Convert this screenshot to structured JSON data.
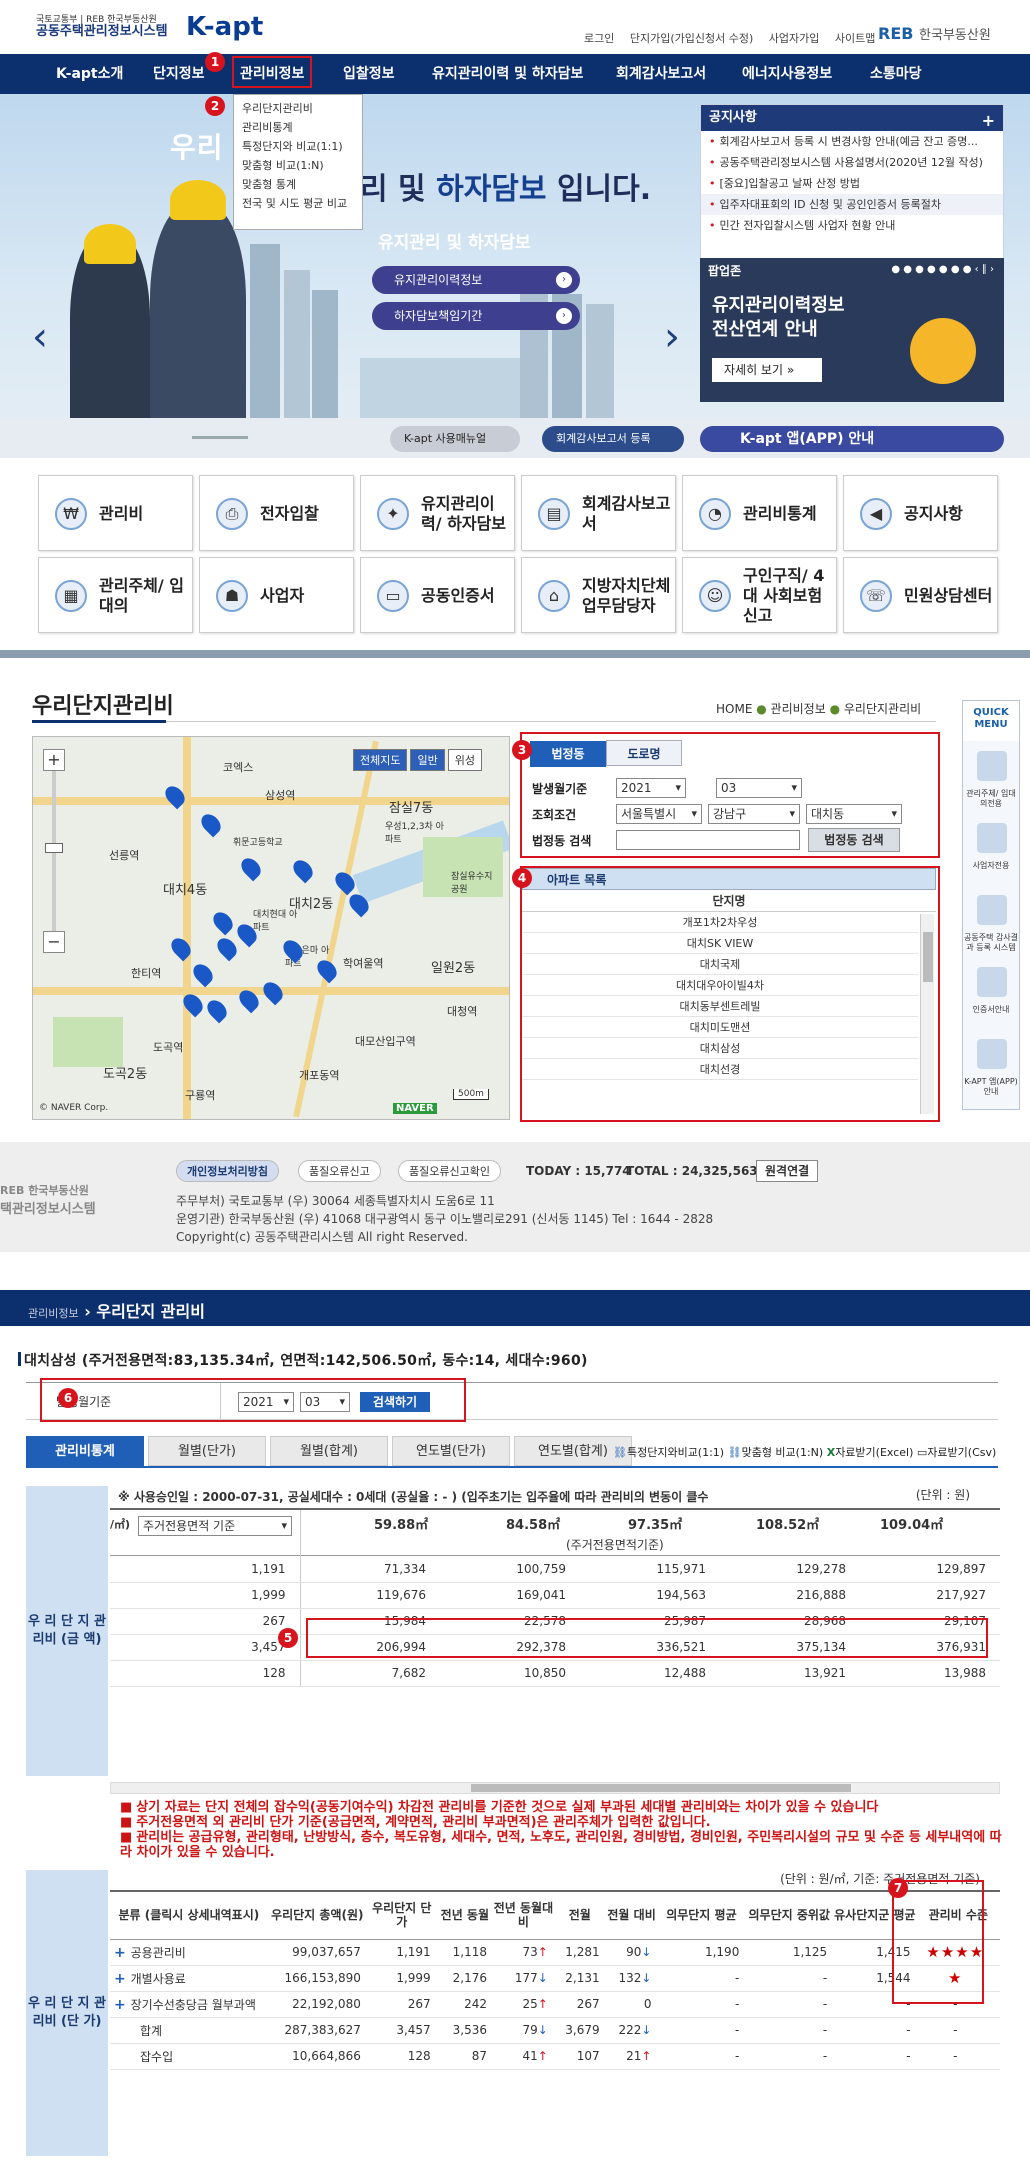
{
  "header": {
    "gov_top": "국토교통부 | REB 한국부동산원",
    "gov_name": "공동주택관리정보시스템",
    "brand": "K-apt",
    "util_links": [
      "로그인",
      "단지가입(가입신청서 수정)",
      "사업자가입",
      "사이트맵"
    ],
    "reb_logo": "REB",
    "reb_name": "한국부동산원"
  },
  "gnb": [
    "K-apt소개",
    "단지정보",
    "관리비정보",
    "입찰정보",
    "유지관리이력 및 하자담보",
    "회계감사보고서",
    "에너지사용정보",
    "소통마당"
  ],
  "dropdown": [
    "우리단지관리비",
    "관리비통계",
    "특정단지와 비교(1:1)",
    "맞춤형 비교(1:N)",
    "맞춤형 통계",
    "전국 및 시도 평균 비교"
  ],
  "badges": [
    "1",
    "2",
    "3",
    "4",
    "5",
    "6",
    "7"
  ],
  "hero": {
    "title_part": "우리",
    "title2_pre": "리",
    "title2_mid": " 및 ",
    "title2_hl": "하자담보",
    "title2_post": " 입니다.",
    "sub": "유지관리 및 하자담보",
    "btn1": "유지관리이력정보",
    "btn2": "하자담보책임기간",
    "bottom_btn1": "K-apt 사용매뉴얼",
    "bottom_btn2": "회계감사보고서 등록",
    "bottom_btn3": "K-apt 앱(APP) 안내"
  },
  "notice": {
    "title": "공지사항",
    "items": [
      "회계감사보고서 등록 시 변경사항 안내(예금 잔고 증명...",
      "공동주택관리정보시스템 사용설명서(2020년 12월 작성)",
      "[중요]입찰공고 날짜 산정 방법",
      "입주자대표회의 ID 신청 및 공인인증서 등록절차",
      "민간 전자입찰시스템 사업자 현황 안내"
    ]
  },
  "popup": {
    "title": "팝업존",
    "line1": "유지관리이력정보",
    "line2": "전산연계 안내",
    "more": "자세히 보기 »"
  },
  "quick_grid": [
    "관리비",
    "전자입찰",
    "유지관리이력/ 하자담보",
    "회계감사보고서",
    "관리비통계",
    "공지사항",
    "관리주체/ 입대의",
    "사업자",
    "공동인증서",
    "지방자치단체 업무담당자",
    "구인구직/ 4대 사회보험 신고",
    "민원상담센터"
  ],
  "section2": {
    "title": "우리단지관리비",
    "breadcrumb": [
      "HOME",
      "관리비정보",
      "우리단지관리비"
    ],
    "map_buttons": [
      "전체지도",
      "일반",
      "위성"
    ],
    "map_labels": [
      "코엑스",
      "삼성역",
      "선릉역",
      "대치4동",
      "대치2동",
      "잠실7동",
      "우성1,2,3차 아파트",
      "한티역",
      "도곡역",
      "도곡2동",
      "구룡역",
      "개포동역",
      "대모산입구역",
      "대청역",
      "일원2동",
      "휘문고등학교",
      "대치현대 아파트",
      "한보은마 아파트",
      "학여울역",
      "잠실유수지 공원",
      "© NAVER Corp.",
      "500m",
      "NAVER"
    ],
    "tabs": [
      "법정동",
      "도로명"
    ],
    "search_labels": [
      "발생월기준",
      "조회조건",
      "법정동 검색"
    ],
    "year": "2021",
    "month": "03",
    "city": "서울특별시",
    "gu": "강남구",
    "dong": "대치동",
    "search_btn": "법정동 검색",
    "apt_head": "아파트 목록",
    "apt_col": "단지명",
    "apt_list": [
      "개포1차2차우성",
      "대치SK VIEW",
      "대치국제",
      "대치대우아이빌4차",
      "대치동부센트레빌",
      "대치미도맨션",
      "대치삼성",
      "대치선경"
    ],
    "quick_title": "QUICK MENU",
    "quick_items": [
      "관리주체/ 입대의전용",
      "사업자전용",
      "공동주택 감사결과 등록 시스템",
      "인증서안내",
      "K-APT 앱(APP) 안내"
    ]
  },
  "footer": {
    "tags": [
      "개인정보처리방침",
      "품질오류신고",
      "품질오류신고확인"
    ],
    "today_label": "TODAY : 15,774",
    "total_label": "TOTAL : 24,325,563",
    "remote_btn": "원격연결",
    "line1": "주무부처) 국토교통부 (우) 30064 세종특별자치시 도움6로 11",
    "line2": "운영기관) 한국부동산원 (우) 41068 대구광역시 동구 이노밸리로291 (신서동 1145) Tel : 1644 - 2828",
    "line3": "Copyright(c) 공동주택관리시스템 All right Reserved.",
    "logo_text": "REB 한국부동산원",
    "logo_sub": "택관리정보시스템"
  },
  "crumb2": {
    "small": "관리비정보",
    "title": "우리단지 관리비"
  },
  "section3": {
    "info": "대치삼성 (주거전용면적:83,135.34㎡, 연면적:142,506.50㎡, 동수:14, 세대수:960)",
    "month_label": "발생월기준",
    "year": "2021",
    "month": "03",
    "search_btn": "검색하기",
    "tabs": [
      "관리비통계",
      "월별(단가)",
      "월별(합계)",
      "연도별(단가)",
      "연도별(합계)"
    ],
    "tab_actions": [
      "특정단지와비교(1:1)",
      "맞춤형 비교(1:N)",
      "자료받기(Excel)",
      "자료받기(Csv)"
    ],
    "side1": "우 리 단 지 관리비 (금 액)",
    "side2": "우 리 단 지 관리비 (단 가)",
    "t1_note": "※ 사용승인일 : 2000-07-31, 공실세대수 : 0세대 (공실율 : - ) (입주초기는 입주율에 따라 관리비의 변동이 클수",
    "t1_unit": "(단위 : 원)",
    "t1_select": "주거전용면적 기준",
    "t1_areas": [
      "59.88㎡",
      "84.58㎡",
      "97.35㎡",
      "108.52㎡",
      "109.04㎡"
    ],
    "t1_caption": "(주거전용면적기준)",
    "t1_rows": [
      [
        "1,191",
        "71,334",
        "100,759",
        "115,971",
        "129,278",
        "129,897"
      ],
      [
        "1,999",
        "119,676",
        "169,041",
        "194,563",
        "216,888",
        "217,927"
      ],
      [
        "267",
        "15,984",
        "22,578",
        "25,987",
        "28,968",
        "29,107"
      ],
      [
        "3,457",
        "206,994",
        "292,378",
        "336,521",
        "375,134",
        "376,931"
      ],
      [
        "128",
        "7,682",
        "10,850",
        "12,488",
        "13,921",
        "13,988"
      ]
    ],
    "warnings": [
      "상기 자료는 단지 전체의 잡수익(공동기여수익) 차감전 관리비를 기준한 것으로 실제 부과된 세대별 관리비와는 차이가 있을 수 있습니다",
      "주거전용면적 외 관리비 단가 기준(공급면적, 계약면적, 관리비 부과면적)은 관리주체가 입력한 값입니다.",
      "관리비는 공급유형, 관리형태, 난방방식, 층수, 복도유형, 세대수, 면적, 노후도, 관리인원, 경비방법, 경비인원, 주민복리시설의 규모 및 수준 등 세부내역에 따라 차이가 있을 수 있습니다."
    ],
    "t2_unit": "(단위 : 원/㎡, 기준: 주거전용면적 기준)",
    "t2_headers": [
      "분류 (클릭시 상세내역표시)",
      "우리단지 총액(원)",
      "우리단지 단가",
      "전년 동월",
      "전년 동월대비",
      "전월",
      "전월 대비",
      "의무단지 평균",
      "의무단지 중위값",
      "유사단지군 평균",
      "관리비 수준"
    ],
    "t2_rows": [
      {
        "name": "공용관리비",
        "plus": true,
        "total": "99,037,657",
        "unit": "1,191",
        "ly": "1,118",
        "lyd": "73",
        "lyd_dir": "up",
        "pm": "1,281",
        "pmd": "90",
        "pmd_dir": "dn",
        "avg": "1,190",
        "med": "1,125",
        "sim": "1,415",
        "level": "★★★★"
      },
      {
        "name": "개별사용료",
        "plus": true,
        "total": "166,153,890",
        "unit": "1,999",
        "ly": "2,176",
        "lyd": "177",
        "lyd_dir": "dn",
        "pm": "2,131",
        "pmd": "132",
        "pmd_dir": "dn",
        "avg": "-",
        "med": "-",
        "sim": "1,544",
        "level": "★"
      },
      {
        "name": "장기수선충당금 월부과액",
        "plus": true,
        "total": "22,192,080",
        "unit": "267",
        "ly": "242",
        "lyd": "25",
        "lyd_dir": "up",
        "pm": "267",
        "pmd": "0",
        "pmd_dir": "",
        "avg": "-",
        "med": "-",
        "sim": "-",
        "level": "-"
      },
      {
        "name": "합계",
        "plus": false,
        "total": "287,383,627",
        "unit": "3,457",
        "ly": "3,536",
        "lyd": "79",
        "lyd_dir": "dn",
        "pm": "3,679",
        "pmd": "222",
        "pmd_dir": "dn",
        "avg": "-",
        "med": "-",
        "sim": "-",
        "level": "-"
      },
      {
        "name": "잡수입",
        "plus": false,
        "total": "10,664,866",
        "unit": "128",
        "ly": "87",
        "lyd": "41",
        "lyd_dir": "up",
        "pm": "107",
        "pmd": "21",
        "pmd_dir": "up",
        "avg": "-",
        "med": "-",
        "sim": "-",
        "level": "-"
      }
    ]
  },
  "colors": {
    "navy": "#0c2f6e",
    "accent_red": "#d7141e",
    "tab_blue": "#1f5fb7"
  }
}
